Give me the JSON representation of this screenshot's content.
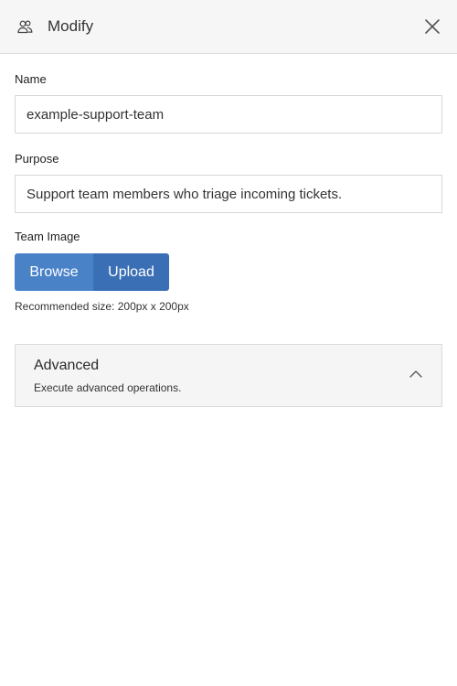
{
  "header": {
    "title": "Modify",
    "icon": "users-icon",
    "close_icon": "close-icon"
  },
  "form": {
    "name_label": "Name",
    "name_value": "example-support-team",
    "purpose_label": "Purpose",
    "purpose_value": "Support team members who triage incoming tickets.",
    "team_image_label": "Team Image",
    "browse_label": "Browse",
    "upload_label": "Upload",
    "recommended_size": "Recommended size: 200px x 200px"
  },
  "advanced": {
    "title": "Advanced",
    "description": "Execute advanced operations.",
    "chevron_icon": "chevron-up-icon"
  },
  "colors": {
    "browse_button": "#4a82c8",
    "upload_button": "#3a6fb5",
    "header_background": "#f6f6f6",
    "panel_background": "#f5f5f5"
  }
}
